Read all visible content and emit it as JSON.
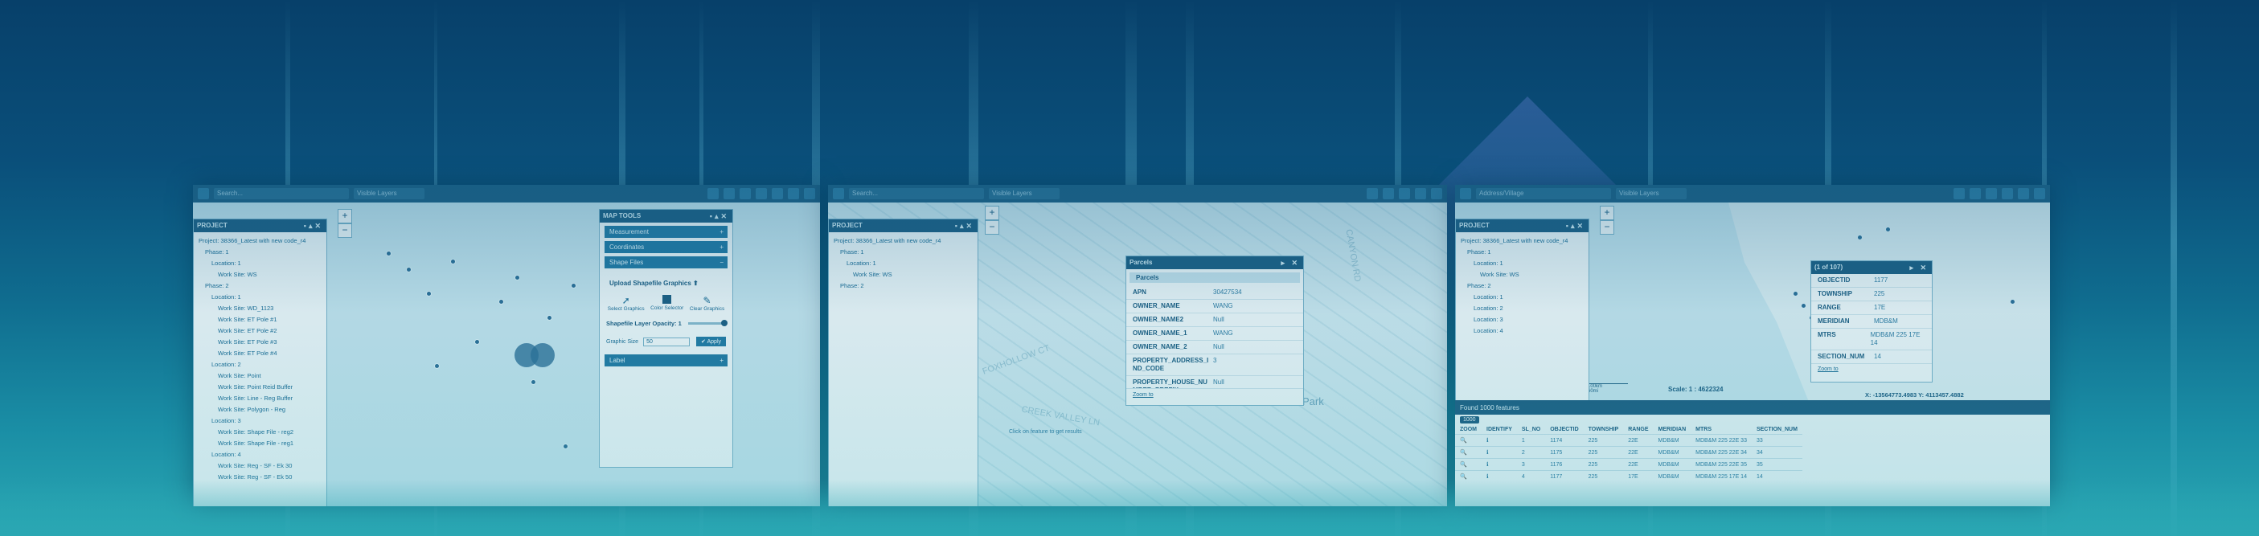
{
  "colors": {
    "accent": "#1d5b80",
    "link": "#1b6a94",
    "bg_top": "#07406a",
    "bg_bottom": "#2aa7b3"
  },
  "toolbar": {
    "search_placeholder": "Search...",
    "address_placeholder": "Address/Village",
    "layers_label": "Visible Layers"
  },
  "left": {
    "project_title": "PROJECT",
    "tree": [
      "Project: 38366_Latest with new code_r4",
      "Phase: 1",
      "Location: 1",
      "Work Site: WS",
      "Phase: 2",
      "Location: 1",
      "Work Site: WD_1123",
      "Work Site: ET Pole #1",
      "Work Site: ET Pole #2",
      "Work Site: ET Pole #3",
      "Work Site: ET Pole #4",
      "Location: 2",
      "Work Site: Point",
      "Work Site: Point Reid Buffer",
      "Work Site: Line - Reg Buffer",
      "Work Site: Polygon - Reg",
      "Location: 3",
      "Work Site: Shape File - reg2",
      "Work Site: Shape File - reg1",
      "Location: 4",
      "Work Site: Reg - SF - Ek 30",
      "Work Site: Reg - SF - Ek 50"
    ],
    "map_tools": {
      "title": "MAP TOOLS",
      "sections": [
        "Measurement",
        "Coordinates",
        "Shape Files"
      ],
      "upload_label": "Upload Shapefile Graphics",
      "tools": [
        "Select Graphics",
        "Color Selector",
        "Clear Graphics"
      ],
      "opacity_label": "Shapefile Layer Opacity: 1",
      "graphic_size_label": "Graphic Size",
      "graphic_size_value": "50",
      "apply_label": "Apply",
      "label_section": "Label"
    }
  },
  "middle": {
    "project_title": "PROJECT",
    "tree": [
      "Project: 38366_Latest with new code_r4",
      "Phase: 1",
      "Location: 1",
      "Work Site: WS",
      "Phase: 2"
    ],
    "popup": {
      "title": "Parcels",
      "subtitle": "Parcels",
      "rows": [
        {
          "k": "APN",
          "v": "30427534"
        },
        {
          "k": "OWNER_NAME",
          "v": "WANG"
        },
        {
          "k": "OWNER_NAME2",
          "v": "Null"
        },
        {
          "k": "OWNER_NAME_1",
          "v": "WANG"
        },
        {
          "k": "OWNER_NAME_2",
          "v": "Null"
        },
        {
          "k": "PROPERTY_ADDRESS_I ND_CODE",
          "v": "3"
        },
        {
          "k": "PROPERTY_HOUSE_NU MBER_PREFIX",
          "v": "Null"
        }
      ],
      "zoom_link": "Zoom to"
    },
    "hint": "Click on feature to get results",
    "streets": [
      "FOXHOLLOW CT",
      "CREEK VALLEY LN",
      "CANYON RD",
      "Park"
    ]
  },
  "right": {
    "project_title": "PROJECT",
    "tree": [
      "Project: 38366_Latest with new code_r4",
      "Phase: 1",
      "Location: 1",
      "Work Site: WS",
      "Phase: 2",
      "Location: 1",
      "Location: 2",
      "Location: 3",
      "Location: 4"
    ],
    "popup": {
      "title": "(1 of 107)",
      "rows": [
        {
          "k": "OBJECTID",
          "v": "1177"
        },
        {
          "k": "TOWNSHIP",
          "v": "225"
        },
        {
          "k": "RANGE",
          "v": "17E"
        },
        {
          "k": "MERIDIAN",
          "v": "MDB&M"
        },
        {
          "k": "MTRS",
          "v": "MDB&M 225 17E 14"
        },
        {
          "k": "SECTION_NUM",
          "v": "14"
        }
      ],
      "zoom_link": "Zoom to"
    },
    "scale_label": "Scale: 1 : 4622324",
    "coords": "X: -13564773.4983   Y: 4113457.4882",
    "scalebar": [
      "100km",
      "60mi"
    ],
    "features_label": "Found 1000 features",
    "page_size": "1000",
    "table": {
      "headers": [
        "ZOOM",
        "IDENTIFY",
        "SL_NO",
        "OBJECTID",
        "TOWNSHIP",
        "RANGE",
        "MERIDIAN",
        "MTRS",
        "SECTION_NUM"
      ],
      "rows": [
        [
          "1",
          "1174",
          "225",
          "22E",
          "MDB&M",
          "MDB&M 225 22E 33",
          "33"
        ],
        [
          "2",
          "1175",
          "225",
          "22E",
          "MDB&M",
          "MDB&M 225 22E 34",
          "34"
        ],
        [
          "3",
          "1176",
          "225",
          "22E",
          "MDB&M",
          "MDB&M 225 22E 35",
          "35"
        ],
        [
          "4",
          "1177",
          "225",
          "17E",
          "MDB&M",
          "MDB&M 225 17E 14",
          "14"
        ]
      ]
    }
  }
}
